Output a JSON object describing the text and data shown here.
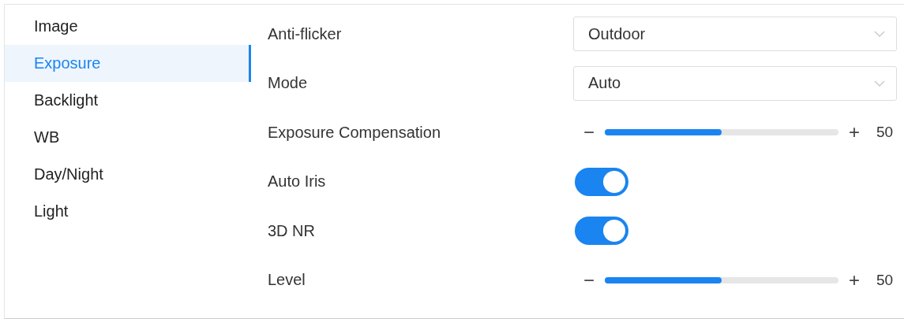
{
  "sidebar": {
    "items": [
      {
        "label": "Image",
        "selected": false
      },
      {
        "label": "Exposure",
        "selected": true
      },
      {
        "label": "Backlight",
        "selected": false
      },
      {
        "label": "WB",
        "selected": false
      },
      {
        "label": "Day/Night",
        "selected": false
      },
      {
        "label": "Light",
        "selected": false
      }
    ]
  },
  "settings": [
    {
      "kind": "select",
      "label": "Anti-flicker",
      "value": "Outdoor"
    },
    {
      "kind": "select",
      "label": "Mode",
      "value": "Auto"
    },
    {
      "kind": "slider",
      "label": "Exposure Compensation",
      "minus": "−",
      "plus": "+",
      "level": 0.5,
      "reading": "50"
    },
    {
      "kind": "switch",
      "label": "Auto Iris",
      "on": true
    },
    {
      "kind": "switch",
      "label": "3D NR",
      "on": true
    },
    {
      "kind": "slider",
      "label": "Level",
      "minus": "−",
      "plus": "+",
      "level": 0.5,
      "reading": "50"
    }
  ]
}
